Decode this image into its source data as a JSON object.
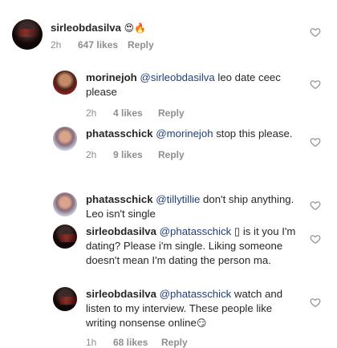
{
  "comments": [
    {
      "username": "sirleobdasilva",
      "mention": "",
      "text": "",
      "emoji": "😍🔥",
      "time": "2h",
      "likes": "647 likes",
      "reply": "Reply"
    },
    {
      "username": "morinejoh",
      "mention": "@sirleobdasilva",
      "text": " leo date ceec please",
      "time": "2h",
      "likes": "4 likes",
      "reply": "Reply"
    },
    {
      "username": "phatasschick",
      "mention": "@morinejoh",
      "text": " stop this please.",
      "time": "2h",
      "likes": "9 likes",
      "reply": "Reply"
    },
    {
      "username": "phatasschick",
      "mention": "@tillytillie",
      "text": " don't ship anything. Leo isn't single"
    },
    {
      "username": "sirleobdasilva",
      "mention": "@phatasschick",
      "text": " ▯ is it you I'm dating? Please i'm single. Liking someone doesn't mean I'm dating the person ma."
    },
    {
      "username": "sirleobdasilva",
      "mention": "@phatasschick",
      "text": " watch and listen to my interview. These people like writing nonsense online",
      "emoji": "😏",
      "time": "1h",
      "likes": "68 likes",
      "reply": "Reply"
    }
  ],
  "icons": {
    "like": "heart-outline-icon"
  },
  "colors": {
    "mention": "#1f3f7a",
    "meta": "#8e8e8e",
    "text": "#262626"
  }
}
